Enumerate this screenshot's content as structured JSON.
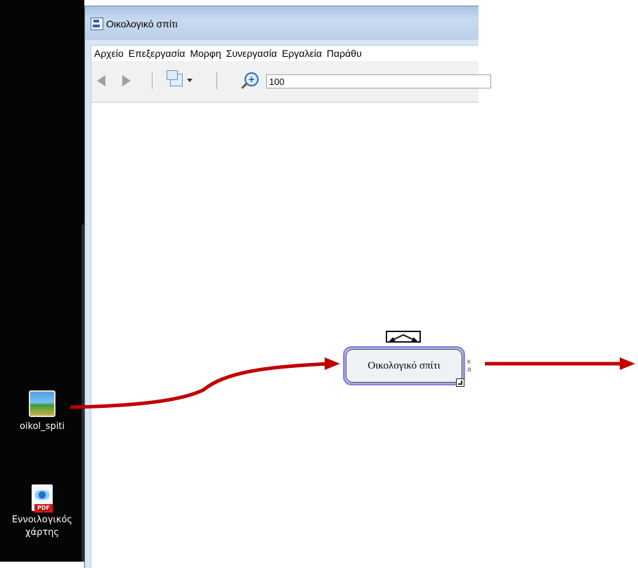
{
  "window": {
    "title": "Οικολογικό σπίτι"
  },
  "menu": [
    {
      "label": "Αρχείο"
    },
    {
      "label": "Επεξεργασία"
    },
    {
      "label": "Μορφη"
    },
    {
      "label": "Συνεργασία"
    },
    {
      "label": "Εργαλεία"
    },
    {
      "label": "Παράθυ"
    }
  ],
  "toolbar": {
    "zoom_value": "100"
  },
  "node": {
    "label": "Οικολογικό σπίτι",
    "side_text": "κ\na"
  },
  "desktop": {
    "icons": [
      {
        "label": "oikol_spiti"
      },
      {
        "label": "Εννοιλογικός\nχάρτης"
      }
    ]
  },
  "colors": {
    "arrow": "#c00000",
    "node_select": "#8a8ae8"
  }
}
